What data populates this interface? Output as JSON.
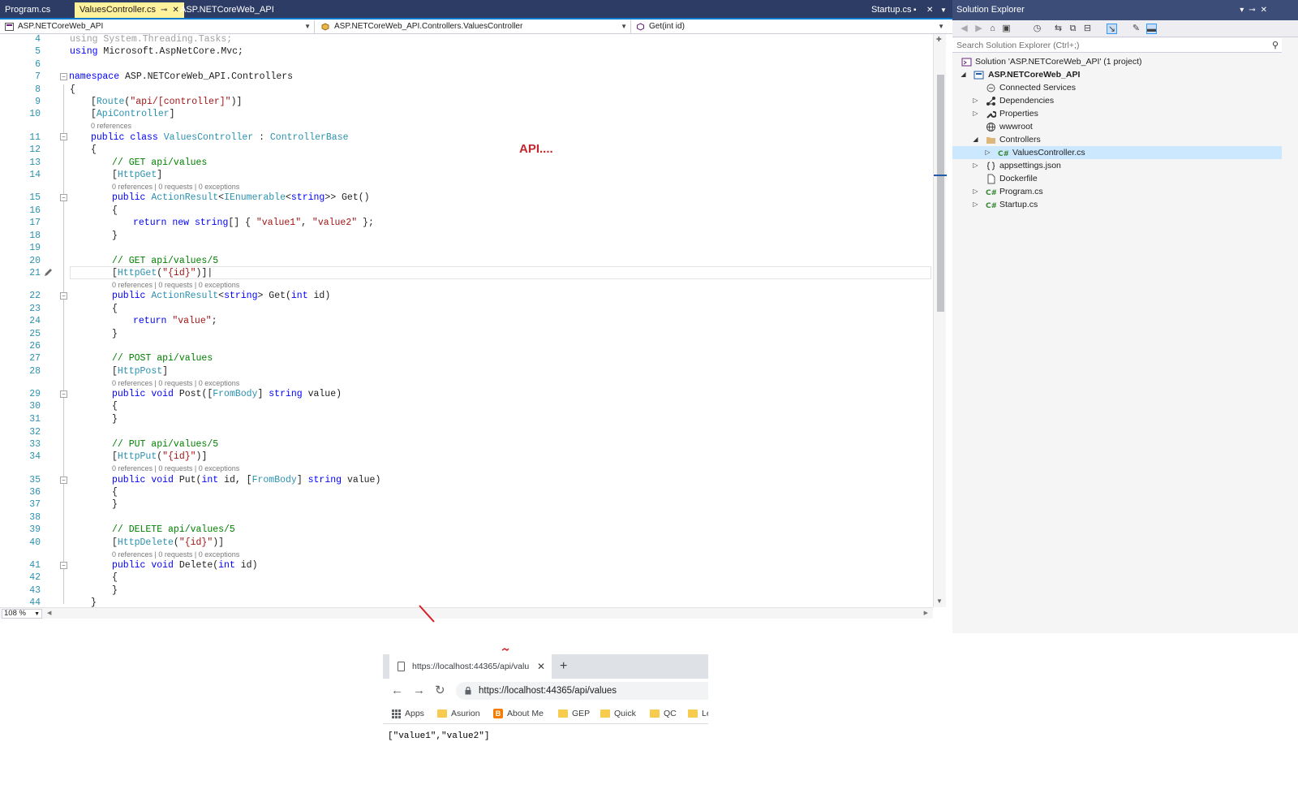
{
  "tabs": [
    {
      "label": "Program.cs",
      "active": false
    },
    {
      "label": "ValuesController.cs",
      "active": true
    },
    {
      "label": "ASP.NETCoreWeb_API",
      "active": false
    }
  ],
  "tab_right": {
    "label": "Startup.cs"
  },
  "nav": {
    "project": "ASP.NETCoreWeb_API",
    "class": "ASP.NETCoreWeb_API.Controllers.ValuesController",
    "member": "Get(int id)"
  },
  "editor": {
    "zoom": "108 %",
    "annotation": "API....",
    "lens_ref": "0 references",
    "lens_full": "0 references | 0 requests | 0 exceptions",
    "lines": [
      {
        "n": "4"
      },
      {
        "n": "5"
      },
      {
        "n": "6"
      },
      {
        "n": "7"
      },
      {
        "n": "8"
      },
      {
        "n": "9"
      },
      {
        "n": "10"
      },
      {
        "n": "11"
      },
      {
        "n": "12"
      },
      {
        "n": "13"
      },
      {
        "n": "14"
      },
      {
        "n": "15"
      },
      {
        "n": "16"
      },
      {
        "n": "17"
      },
      {
        "n": "18"
      },
      {
        "n": "19"
      },
      {
        "n": "20"
      },
      {
        "n": "21"
      },
      {
        "n": "22"
      },
      {
        "n": "23"
      },
      {
        "n": "24"
      },
      {
        "n": "25"
      },
      {
        "n": "26"
      },
      {
        "n": "27"
      },
      {
        "n": "28"
      },
      {
        "n": "29"
      },
      {
        "n": "30"
      },
      {
        "n": "31"
      },
      {
        "n": "32"
      },
      {
        "n": "33"
      },
      {
        "n": "34"
      },
      {
        "n": "35"
      },
      {
        "n": "36"
      },
      {
        "n": "37"
      },
      {
        "n": "38"
      },
      {
        "n": "39"
      },
      {
        "n": "40"
      },
      {
        "n": "41"
      },
      {
        "n": "42"
      },
      {
        "n": "43"
      },
      {
        "n": "44"
      }
    ],
    "code": {
      "l4_using": "using",
      "l4_rest": " System.Threading.Tasks;",
      "l5_using": "using",
      "l5_rest": " Microsoft.AspNetCore.Mvc;",
      "l7_ns": "namespace",
      "l7_rest": " ASP.NETCoreWeb_API.Controllers",
      "brace_open": "{",
      "brace_close": "}",
      "l9_a": "[",
      "l9_route": "Route",
      "l9_b": "(",
      "l9_str": "\"api/[controller]\"",
      "l9_c": ")]",
      "l10_a": "[",
      "l10_attr": "ApiController",
      "l10_b": "]",
      "l11_public": "public",
      "l11_class": "class",
      "l11_name": "ValuesController",
      "l11_colon": " : ",
      "l11_base": "ControllerBase",
      "l13": "// GET api/values",
      "l14_a": "[",
      "l14_attr": "HttpGet",
      "l14_b": "]",
      "l15_public": "public",
      "l15_t1": "ActionResult",
      "l15_lt": "<",
      "l15_t2": "IEnumerable",
      "l15_lt2": "<",
      "l15_kw": "string",
      "l15_rest": ">> Get()",
      "l17_return": "return",
      "l17_new": "new",
      "l17_string": "string",
      "l17_mid": "[] { ",
      "l17_s1": "\"value1\"",
      "l17_comma": ", ",
      "l17_s2": "\"value2\"",
      "l17_end": " };",
      "l20": "// GET api/values/5",
      "l21_a": "[",
      "l21_attr": "HttpGet",
      "l21_b": "(",
      "l21_str": "\"{id}\"",
      "l21_c": ")]",
      "l22_public": "public",
      "l22_t1": "ActionResult",
      "l22_lt": "<",
      "l22_kw": "string",
      "l22_rest": "> Get(",
      "l22_int": "int",
      "l22_end": " id)",
      "l24_return": "return",
      "l24_str": "\"value\"",
      "l24_end": ";",
      "l27": "// POST api/values",
      "l28_a": "[",
      "l28_attr": "HttpPost",
      "l28_b": "]",
      "l29_public": "public",
      "l29_void": "void",
      "l29_mid": " Post([",
      "l29_attr": "FromBody",
      "l29_mid2": "] ",
      "l29_kw": "string",
      "l29_end": " value)",
      "l33": "// PUT api/values/5",
      "l34_a": "[",
      "l34_attr": "HttpPut",
      "l34_b": "(",
      "l34_str": "\"{id}\"",
      "l34_c": ")]",
      "l35_public": "public",
      "l35_void": "void",
      "l35_mid": " Put(",
      "l35_int": "int",
      "l35_mid2": " id, [",
      "l35_attr": "FromBody",
      "l35_mid3": "] ",
      "l35_kw": "string",
      "l35_end": " value)",
      "l39": "// DELETE api/values/5",
      "l40_a": "[",
      "l40_attr": "HttpDelete",
      "l40_b": "(",
      "l40_str": "\"{id}\"",
      "l40_c": ")]",
      "l41_public": "public",
      "l41_void": "void",
      "l41_mid": " Delete(",
      "l41_int": "int",
      "l41_end": " id)"
    }
  },
  "solution_explorer": {
    "title": "Solution Explorer",
    "search_placeholder": "Search Solution Explorer (Ctrl+;)",
    "tree": {
      "solution": "Solution 'ASP.NETCoreWeb_API' (1 project)",
      "project": "ASP.NETCoreWeb_API",
      "connected": "Connected Services",
      "dependencies": "Dependencies",
      "properties": "Properties",
      "wwwroot": "wwwroot",
      "controllers": "Controllers",
      "values_controller": "ValuesController.cs",
      "appsettings": "appsettings.json",
      "dockerfile": "Dockerfile",
      "program": "Program.cs",
      "startup": "Startup.cs"
    }
  },
  "browser": {
    "tab_title": "https://localhost:44365/api/valu",
    "url": "https://localhost:44365/api/values",
    "bookmarks": [
      "Apps",
      "Asurion",
      "About Me",
      "GEP",
      "Quick",
      "QC",
      "Le"
    ],
    "body": "[\"value1\",\"value2\"]"
  },
  "colors": {
    "tab_bar": "#2d3c64",
    "active_tab": "#fff29d",
    "keyword": "#0000ff",
    "type": "#2b91af",
    "string": "#a31515",
    "comment": "#008000",
    "annotation": "#c0282d"
  }
}
